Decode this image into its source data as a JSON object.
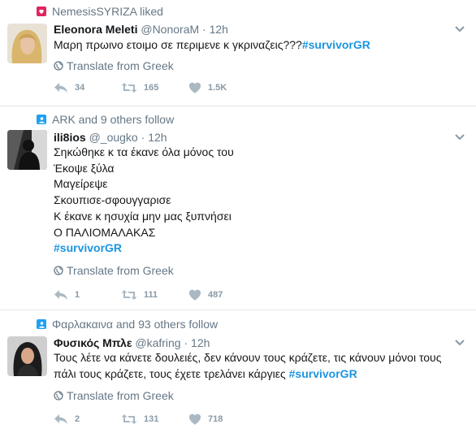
{
  "tweets": [
    {
      "context": "NemesisSYRIZA liked",
      "name": "Eleonora Meleti",
      "handle": "@NonoraM",
      "dot": "·",
      "time": "12h",
      "lines": [
        "Μαρη πρωινο ετοιμο σε περιμενε κ γκριναζεις???"
      ],
      "hashtag": "#survivorGR",
      "translate": "Translate from Greek",
      "reply_count": "34",
      "retweet_count": "165",
      "like_count": "1.5K"
    },
    {
      "context": "ARK and 9 others follow",
      "name": "ili8ios",
      "handle": "@_ougko",
      "dot": "·",
      "time": "12h",
      "lines": [
        "Σηκώθηκε κ τα έκανε όλα μόνος του",
        "Έκοψε ξύλα",
        "Μαγείρεψε",
        "Σκουπισε-σφουγγαρισε",
        "Κ έκανε κ ησυχία μην μας ξυπνήσει",
        "Ο ΠΑΛΙΟΜΑΛΑΚΑΣ"
      ],
      "hashtag": "#survivorGR",
      "translate": "Translate from Greek",
      "reply_count": "1",
      "retweet_count": "111",
      "like_count": "487"
    },
    {
      "context": "Φαρλακαινα and 93 others follow",
      "name": "Φυσικός Μπλε",
      "handle": "@kafring",
      "dot": "·",
      "time": "12h",
      "lines": [
        "Τους λέτε να κάνετε δουλειές, δεν κάνουν τους κράζετε, τις κάνουν μόνοι τους",
        "πάλι τους κράζετε, τους έχετε τρελάνει κάργιες"
      ],
      "hashtag": "#survivorGR",
      "translate": "Translate from Greek",
      "reply_count": "2",
      "retweet_count": "131",
      "like_count": "718"
    }
  ],
  "colors": {
    "accent": "#1b95e0",
    "like": "#e0245e",
    "muted": "#657786",
    "action": "#8899a6"
  }
}
